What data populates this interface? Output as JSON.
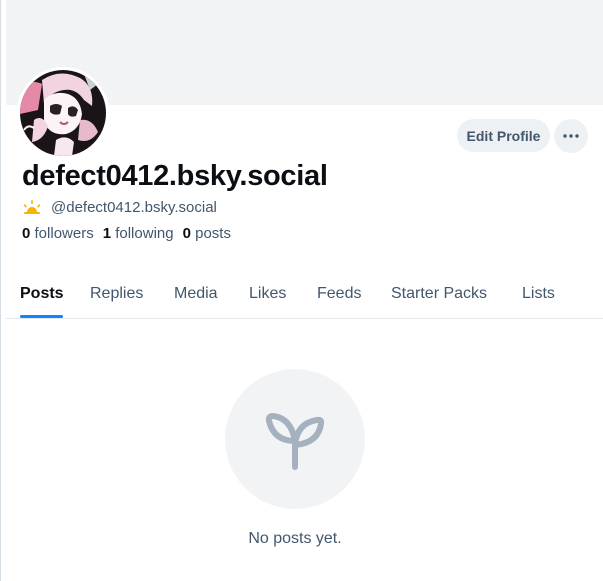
{
  "profile": {
    "display_name": "defect0412.bsky.social",
    "handle": "@defect0412.bsky.social",
    "edit_label": "Edit Profile",
    "stats": {
      "followers_count": "0",
      "followers_label": "followers",
      "following_count": "1",
      "following_label": "following",
      "posts_count": "0",
      "posts_label": "posts"
    }
  },
  "tabs": [
    {
      "label": "Posts",
      "active": true
    },
    {
      "label": "Replies"
    },
    {
      "label": "Media"
    },
    {
      "label": "Likes"
    },
    {
      "label": "Feeds"
    },
    {
      "label": "Starter Packs"
    },
    {
      "label": "Lists"
    }
  ],
  "empty_state": {
    "message": "No posts yet.",
    "icon": "sprout-icon"
  },
  "colors": {
    "accent": "#1083fe",
    "muted_text": "#42576c",
    "banner": "#f1f3f5"
  }
}
